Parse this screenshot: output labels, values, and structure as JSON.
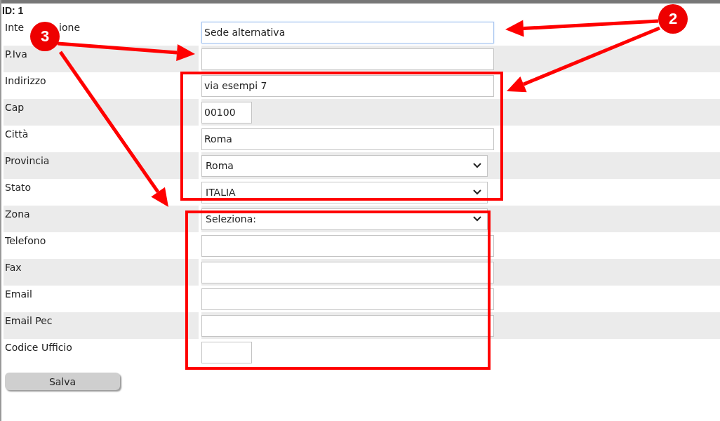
{
  "record_id": "ID: 1",
  "fields": [
    {
      "label_parts": [
        "Inte",
        "ione"
      ],
      "kind": "text",
      "value": "Sede alternativa",
      "focused": true
    },
    {
      "label_parts": [
        "P.Iva"
      ],
      "kind": "text",
      "focused": false
    },
    {
      "label_parts": [
        "Indirizzo"
      ],
      "kind": "text",
      "value": "via esempi 7",
      "focused": false
    },
    {
      "label_parts": [
        "Cap"
      ],
      "kind": "short",
      "value": "00100",
      "focused": false
    },
    {
      "label_parts": [
        "Città"
      ],
      "kind": "text",
      "value": "Roma",
      "focused": false
    },
    {
      "label_parts": [
        "Provincia"
      ],
      "kind": "select",
      "value": "Roma",
      "focused": false
    },
    {
      "label_parts": [
        "Stato"
      ],
      "kind": "select",
      "value": "ITALIA",
      "focused": false
    },
    {
      "label_parts": [
        "Zona"
      ],
      "kind": "select",
      "value": "Seleziona:",
      "focused": false
    },
    {
      "label_parts": [
        "Telefono"
      ],
      "kind": "text",
      "focused": false
    },
    {
      "label_parts": [
        "Fax"
      ],
      "kind": "text",
      "focused": false
    },
    {
      "label_parts": [
        "Email"
      ],
      "kind": "text",
      "focused": false
    },
    {
      "label_parts": [
        "Email Pec"
      ],
      "kind": "text",
      "focused": false
    },
    {
      "label_parts": [
        "Codice Ufficio"
      ],
      "kind": "short",
      "focused": false
    }
  ],
  "save_button": "Salva",
  "callouts": [
    {
      "label": "3"
    },
    {
      "label": "2"
    }
  ]
}
